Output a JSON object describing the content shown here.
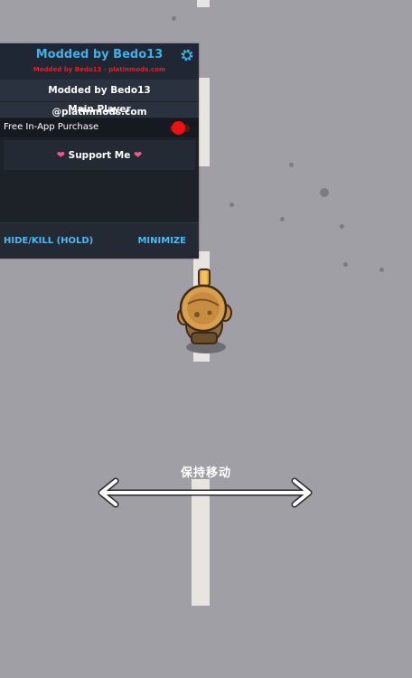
{
  "mod_menu": {
    "title": "Modded by Bedo13",
    "subtitle": "Modded by Bedo13 - platinmods.com",
    "credit": "Modded by Bedo13 @platinmods.com",
    "section": "Main Player",
    "toggles": [
      {
        "label": "Free In-App Purchase",
        "enabled": true
      }
    ],
    "support_button": {
      "label": "Support Me",
      "icon": "heart-icon"
    },
    "footer": {
      "hide_kill_label": "HIDE/KILL (HOLD)",
      "minimize_label": "MINIMIZE"
    },
    "colors": {
      "title": "#3fb0e8",
      "subtitle": "#e02222",
      "accent": "#4fb8f2",
      "toggle_on": "#f01010"
    }
  },
  "game": {
    "hint_text": "保持移动",
    "hint_icon": "double-arrow-icon"
  }
}
